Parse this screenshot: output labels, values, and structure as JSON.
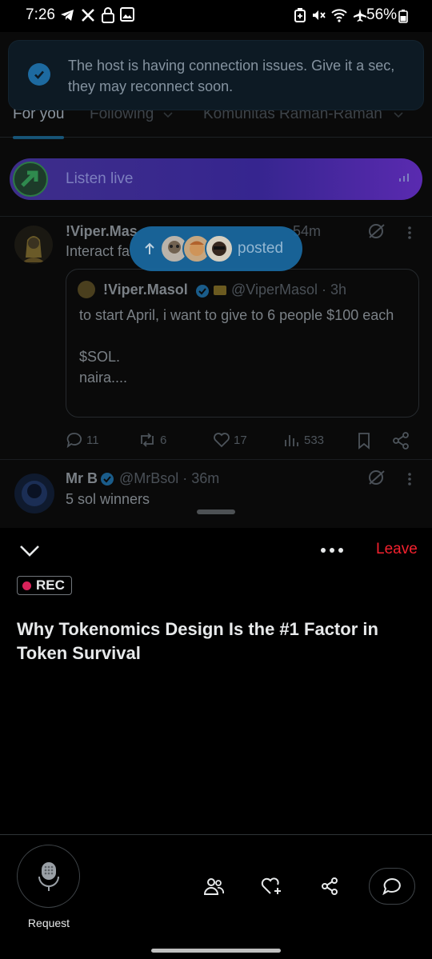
{
  "status_bar": {
    "time": "7:26",
    "battery": "56%"
  },
  "toast": {
    "message": "The host is having connection issues. Give it a sec, they may reconnect soon."
  },
  "tabs": [
    {
      "label": "For you",
      "active": true
    },
    {
      "label": "Following",
      "active": false
    },
    {
      "label": "Komunitas Ramah-Ramah",
      "active": false
    }
  ],
  "listen_live": {
    "label": "Listen live"
  },
  "posts": [
    {
      "name": "!Viper.Mas",
      "time": "54m",
      "text": "Interact fa",
      "quote": {
        "name": "!Viper.Masol",
        "handle": "@ViperMasol · 3h",
        "text": "to start April, i want to give to 6 people $100 each\n\n$SOL.\nnaira...."
      },
      "stats": {
        "replies": "11",
        "reposts": "6",
        "likes": "17",
        "views": "533"
      }
    },
    {
      "name": "Mr B",
      "handle": "@MrBsol · 36m",
      "text": "5 sol winners"
    }
  ],
  "posted_pill": {
    "label": "posted"
  },
  "space": {
    "leave_label": "Leave",
    "rec_label": "REC",
    "title": "Why Tokenomics Design Is the #1 Factor in Token Survival",
    "request_label": "Request"
  },
  "colors": {
    "accent": "#1d9bf0",
    "leave": "#f4212e",
    "rec_dot": "#d9225a"
  }
}
